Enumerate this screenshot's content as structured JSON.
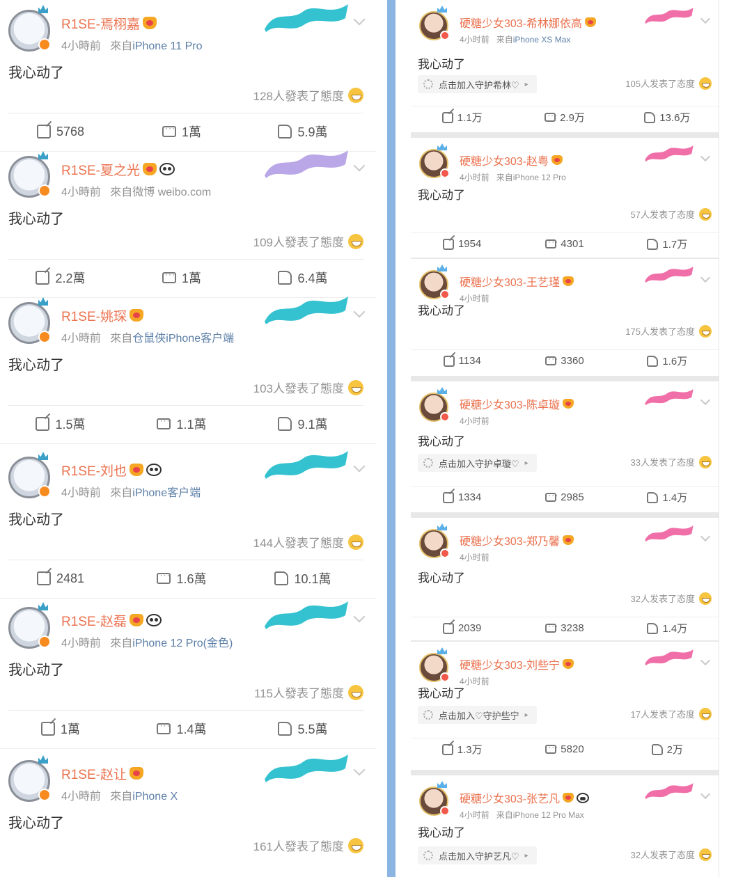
{
  "left_posts": [
    {
      "name": "R1SE-焉栩嘉",
      "time": "4小時前",
      "source_prefix": "來自",
      "source": "iPhone 11 Pro",
      "text": "我心动了",
      "attitude": "128人發表了態度",
      "share": "5768",
      "comment": "1萬",
      "like": "5.9萬",
      "panda": false
    },
    {
      "name": "R1SE-夏之光",
      "time": "4小時前",
      "source_prefix": "來自",
      "source": "微博 weibo.com",
      "text": "我心动了",
      "attitude": "109人發表了態度",
      "share": "2.2萬",
      "comment": "1萬",
      "like": "6.4萬",
      "panda": true
    },
    {
      "name": "R1SE-姚琛",
      "time": "4小時前",
      "source_prefix": "來自",
      "source": "仓鼠侠iPhone客户端",
      "text": "我心动了",
      "attitude": "103人發表了態度",
      "share": "1.5萬",
      "comment": "1.1萬",
      "like": "9.1萬",
      "panda": false
    },
    {
      "name": "R1SE-刘也",
      "time": "4小時前",
      "source_prefix": "來自",
      "source": "iPhone客户端",
      "text": "我心动了",
      "attitude": "144人發表了態度",
      "share": "2481",
      "comment": "1.6萬",
      "like": "10.1萬",
      "panda": true
    },
    {
      "name": "R1SE-赵磊",
      "time": "4小時前",
      "source_prefix": "來自",
      "source": "iPhone 12 Pro(金色)",
      "text": "我心动了",
      "attitude": "115人發表了態度",
      "share": "1萬",
      "comment": "1.4萬",
      "like": "5.5萬",
      "panda": true
    },
    {
      "name": "R1SE-赵让",
      "time": "4小時前",
      "source_prefix": "來自",
      "source": "iPhone X",
      "text": "我心动了",
      "attitude": "161人發表了態度",
      "share": "",
      "comment": "",
      "like": "",
      "panda": false
    }
  ],
  "right_posts": [
    {
      "name": "硬糖少女303-希林娜依高",
      "time": "4小时前",
      "source_prefix": "来自",
      "source": "iPhone XS Max",
      "text": "我心动了",
      "guard": "点击加入守护希林♡",
      "attitude": "105人发表了态度",
      "share": "1.1万",
      "comment": "2.9万",
      "like": "13.6万",
      "panda": false
    },
    {
      "name": "硬糖少女303-赵粤",
      "time": "4小时前",
      "source_prefix": "来自",
      "source": "iPhone 12 Pro",
      "text": "我心动了",
      "guard": "",
      "attitude": "57人发表了态度",
      "share": "1954",
      "comment": "4301",
      "like": "1.7万",
      "panda": false
    },
    {
      "name": "硬糖少女303-王艺瑾",
      "time": "4小时前",
      "source_prefix": "",
      "source": "",
      "text": "我心动了",
      "guard": "",
      "attitude": "175人发表了态度",
      "share": "1134",
      "comment": "3360",
      "like": "1.6万",
      "panda": false
    },
    {
      "name": "硬糖少女303-陈卓璇",
      "time": "4小时前",
      "source_prefix": "",
      "source": "",
      "text": "我心动了",
      "guard": "点击加入守护卓璇♡",
      "attitude": "33人发表了态度",
      "share": "1334",
      "comment": "2985",
      "like": "1.4万",
      "panda": false
    },
    {
      "name": "硬糖少女303-郑乃馨",
      "time": "4小时前",
      "source_prefix": "",
      "source": "",
      "text": "我心动了",
      "guard": "",
      "attitude": "32人发表了态度",
      "share": "2039",
      "comment": "3238",
      "like": "1.4万",
      "panda": false
    },
    {
      "name": "硬糖少女303-刘些宁",
      "time": "4小时前",
      "source_prefix": "",
      "source": "",
      "text": "我心动了",
      "guard": "点击加入♡守护些宁",
      "attitude": "17人发表了态度",
      "share": "1.3万",
      "comment": "5820",
      "like": "2万",
      "panda": false
    },
    {
      "name": "硬糖少女303-张艺凡",
      "time": "4小时前",
      "source_prefix": "来自",
      "source": "iPhone 12 Pro Max",
      "text": "我心动了",
      "guard": "点击加入守护艺凡♡",
      "attitude": "32人发表了态度",
      "share": "",
      "comment": "",
      "like": "",
      "panda": true
    }
  ],
  "colors": {
    "name": "#eb7350",
    "source_link": "#5d7fa8",
    "divider": "#8ab4e2",
    "deco_left": "#35c2d0",
    "deco_right": "#f06fa8"
  },
  "icons": [
    "share-icon",
    "comment-icon",
    "like-icon",
    "crown-icon",
    "panda-icon",
    "laugh-emoji-icon",
    "chevron-down-icon",
    "guard-icon"
  ]
}
